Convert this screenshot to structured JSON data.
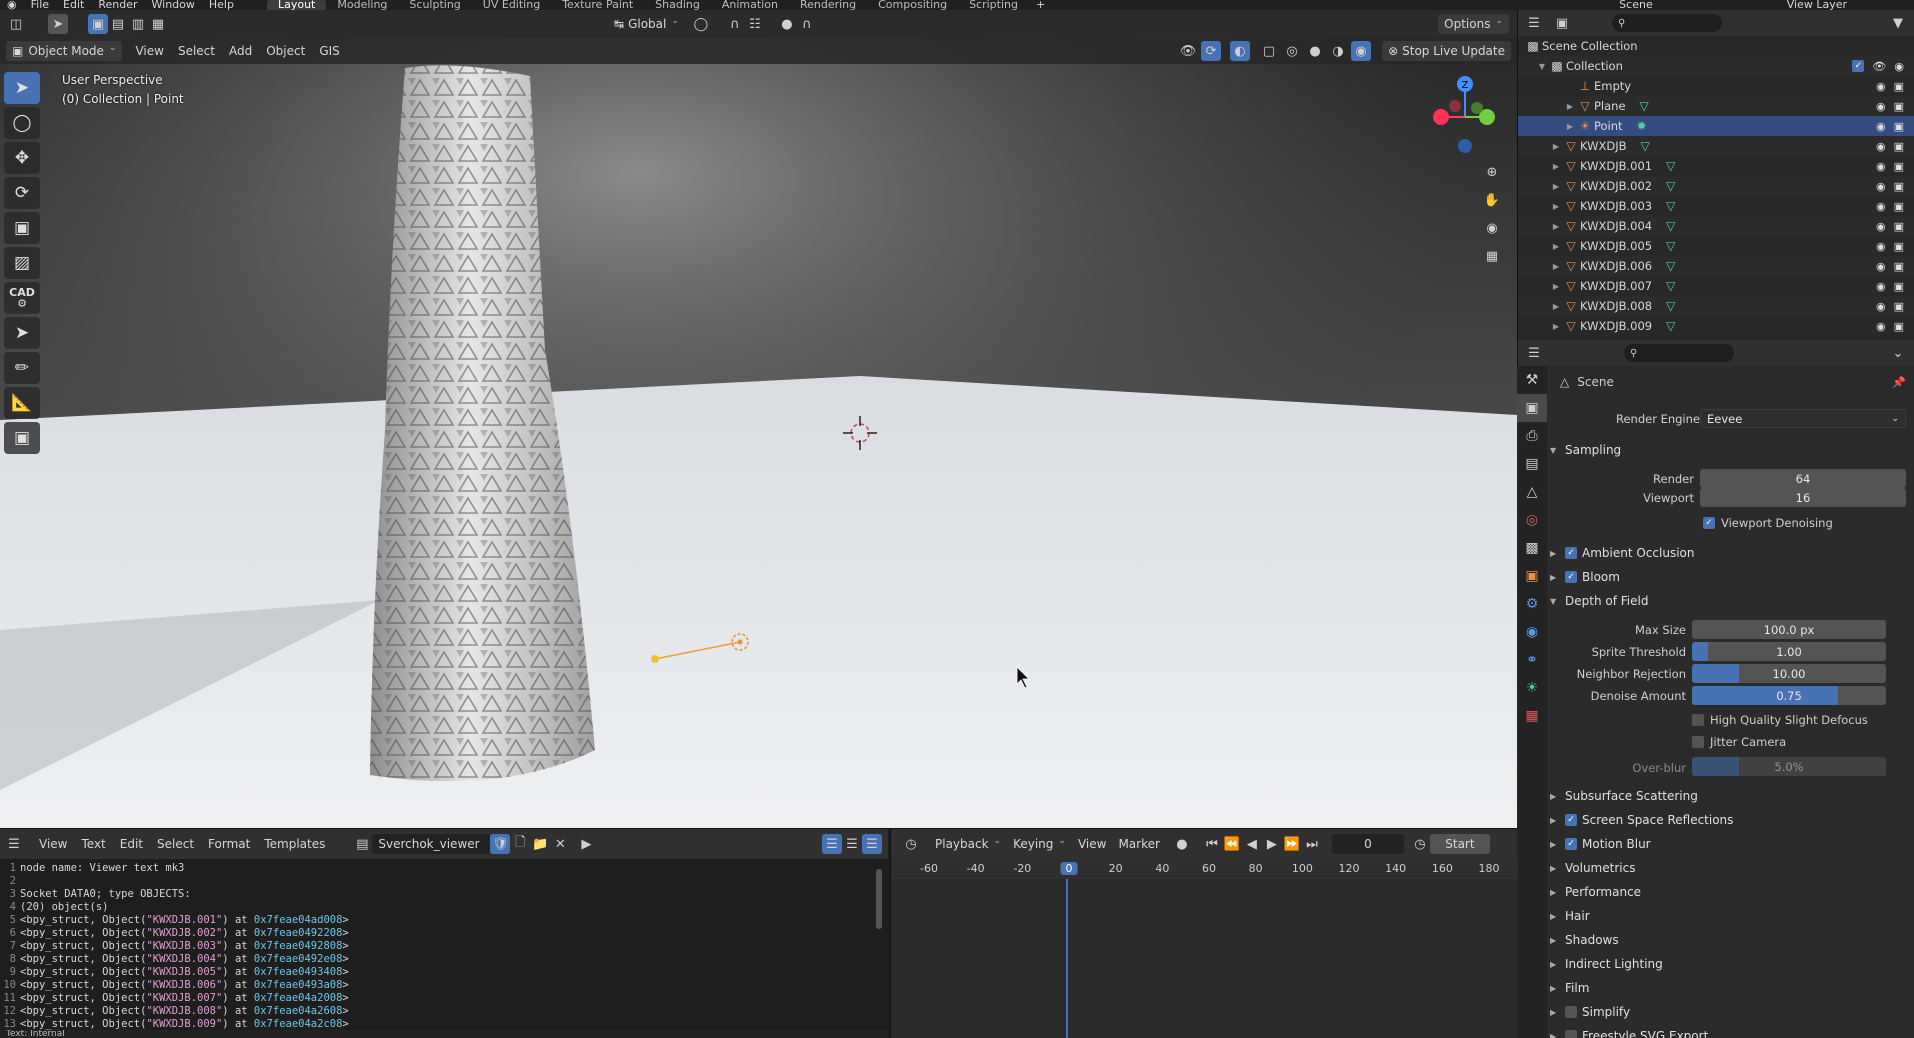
{
  "menubar": {
    "menus": [
      "File",
      "Edit",
      "Render",
      "Window",
      "Help"
    ],
    "workspaces": [
      "Layout",
      "Modeling",
      "Sculpting",
      "UV Editing",
      "Texture Paint",
      "Shading",
      "Animation",
      "Rendering",
      "Compositing",
      "Scripting"
    ],
    "active_workspace": "Layout",
    "scene": "Scene",
    "view_layer": "View Layer"
  },
  "viewport": {
    "transform_orientation": "Global",
    "options_label": "Options",
    "mode": "Object Mode",
    "menus": [
      "View",
      "Select",
      "Add",
      "Object",
      "GIS"
    ],
    "perspective": "User Perspective",
    "collection_info": "(0) Collection | Point",
    "stop_live_update": "Stop Live Update",
    "gizmo_z": "Z"
  },
  "toolbar": {
    "cad_label": "CAD"
  },
  "outliner": {
    "root": "Scene Collection",
    "collection": "Collection",
    "items": [
      {
        "name": "Empty",
        "type": "empty",
        "indent": 2,
        "expand": false,
        "mesh": false,
        "selected": false
      },
      {
        "name": "Plane",
        "type": "mesh",
        "indent": 2,
        "expand": true,
        "mesh": true,
        "selected": false
      },
      {
        "name": "Point",
        "type": "light",
        "indent": 2,
        "expand": true,
        "mesh": false,
        "selected": true
      },
      {
        "name": "KWXDJB",
        "type": "mesh",
        "indent": 1,
        "expand": true,
        "mesh": true,
        "selected": false
      },
      {
        "name": "KWXDJB.001",
        "type": "mesh",
        "indent": 1,
        "expand": true,
        "mesh": true,
        "selected": false
      },
      {
        "name": "KWXDJB.002",
        "type": "mesh",
        "indent": 1,
        "expand": true,
        "mesh": true,
        "selected": false
      },
      {
        "name": "KWXDJB.003",
        "type": "mesh",
        "indent": 1,
        "expand": true,
        "mesh": true,
        "selected": false
      },
      {
        "name": "KWXDJB.004",
        "type": "mesh",
        "indent": 1,
        "expand": true,
        "mesh": true,
        "selected": false
      },
      {
        "name": "KWXDJB.005",
        "type": "mesh",
        "indent": 1,
        "expand": true,
        "mesh": true,
        "selected": false
      },
      {
        "name": "KWXDJB.006",
        "type": "mesh",
        "indent": 1,
        "expand": true,
        "mesh": true,
        "selected": false
      },
      {
        "name": "KWXDJB.007",
        "type": "mesh",
        "indent": 1,
        "expand": true,
        "mesh": true,
        "selected": false
      },
      {
        "name": "KWXDJB.008",
        "type": "mesh",
        "indent": 1,
        "expand": true,
        "mesh": true,
        "selected": false
      },
      {
        "name": "KWXDJB.009",
        "type": "mesh",
        "indent": 1,
        "expand": true,
        "mesh": true,
        "selected": false
      }
    ]
  },
  "properties": {
    "context": "Scene",
    "render_engine_label": "Render Engine",
    "render_engine": "Eevee",
    "sampling": {
      "title": "Sampling",
      "render_label": "Render",
      "render": "64",
      "viewport_label": "Viewport",
      "viewport": "16",
      "denoise_label": "Viewport Denoising",
      "denoise": true
    },
    "ambient_occlusion": "Ambient Occlusion",
    "bloom": "Bloom",
    "dof": {
      "title": "Depth of Field",
      "fields": [
        {
          "label": "Max Size",
          "value": "100.0 px",
          "fill": 0
        },
        {
          "label": "Sprite Threshold",
          "value": "1.00",
          "fill": 0.08
        },
        {
          "label": "Neighbor Rejection",
          "value": "10.00",
          "fill": 0.24
        },
        {
          "label": "Denoise Amount",
          "value": "0.75",
          "fill": 0.75
        }
      ],
      "hq_defocus": "High Quality Slight Defocus",
      "jitter": "Jitter Camera",
      "overblur_label": "Over-blur",
      "overblur": "5.0%",
      "overblur_fill": 0.24
    },
    "panels": [
      {
        "label": "Subsurface Scattering",
        "check": null
      },
      {
        "label": "Screen Space Reflections",
        "check": true
      },
      {
        "label": "Motion Blur",
        "check": true
      },
      {
        "label": "Volumetrics",
        "check": null
      },
      {
        "label": "Performance",
        "check": null
      },
      {
        "label": "Hair",
        "check": null
      },
      {
        "label": "Shadows",
        "check": null
      },
      {
        "label": "Indirect Lighting",
        "check": null
      },
      {
        "label": "Film",
        "check": null
      },
      {
        "label": "Simplify",
        "check": false
      },
      {
        "label": "Freestyle SVG Export",
        "check": false
      }
    ]
  },
  "text_editor": {
    "menus": [
      "View",
      "Text",
      "Edit",
      "Select",
      "Format",
      "Templates"
    ],
    "text_name": "Sverchok_viewer",
    "lines": [
      "node name: Viewer text mk3",
      "",
      "Socket DATA0; type OBJECTS:",
      "(20) object(s)",
      "<bpy_struct, Object(\"KWXDJB.001\") at 0x7feae04ad008>",
      "<bpy_struct, Object(\"KWXDJB.002\") at 0x7feae0492208>",
      "<bpy_struct, Object(\"KWXDJB.003\") at 0x7feae0492808>",
      "<bpy_struct, Object(\"KWXDJB.004\") at 0x7feae0492e08>",
      "<bpy_struct, Object(\"KWXDJB.005\") at 0x7feae0493408>",
      "<bpy_struct, Object(\"KWXDJB.006\") at 0x7feae0493a08>",
      "<bpy_struct, Object(\"KWXDJB.007\") at 0x7feae04a2008>",
      "<bpy_struct, Object(\"KWXDJB.008\") at 0x7feae04a2608>",
      "<bpy_struct, Object(\"KWXDJB.009\") at 0x7feae04a2c08>"
    ]
  },
  "timeline": {
    "menus": [
      "Playback",
      "Keying",
      "View",
      "Marker"
    ],
    "current_frame": "0",
    "start_label": "Start",
    "ticks": [
      "-60",
      "-40",
      "-20",
      "0",
      "20",
      "40",
      "60",
      "80",
      "100",
      "120",
      "140",
      "160",
      "180"
    ]
  },
  "status": {
    "text": "Text: Internal"
  },
  "colors": {
    "accent": "#4772b3",
    "selected_row": "#334d80",
    "mesh_icon": "#4fd1a0",
    "object_icon": "#e8914a"
  }
}
